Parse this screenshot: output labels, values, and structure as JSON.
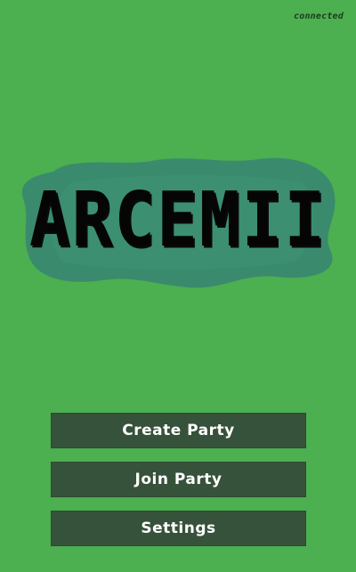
{
  "status": {
    "connection_text": "connected"
  },
  "logo": {
    "text": "ARCEMII"
  },
  "menu": {
    "buttons": [
      {
        "label": "Create Party"
      },
      {
        "label": "Join Party"
      },
      {
        "label": "Settings"
      }
    ]
  },
  "colors": {
    "background": "#4caf50",
    "logo_blob": "#3a8a6e",
    "button_bg": "#37523a",
    "button_text": "#ffffff",
    "logo_text": "#050505"
  }
}
